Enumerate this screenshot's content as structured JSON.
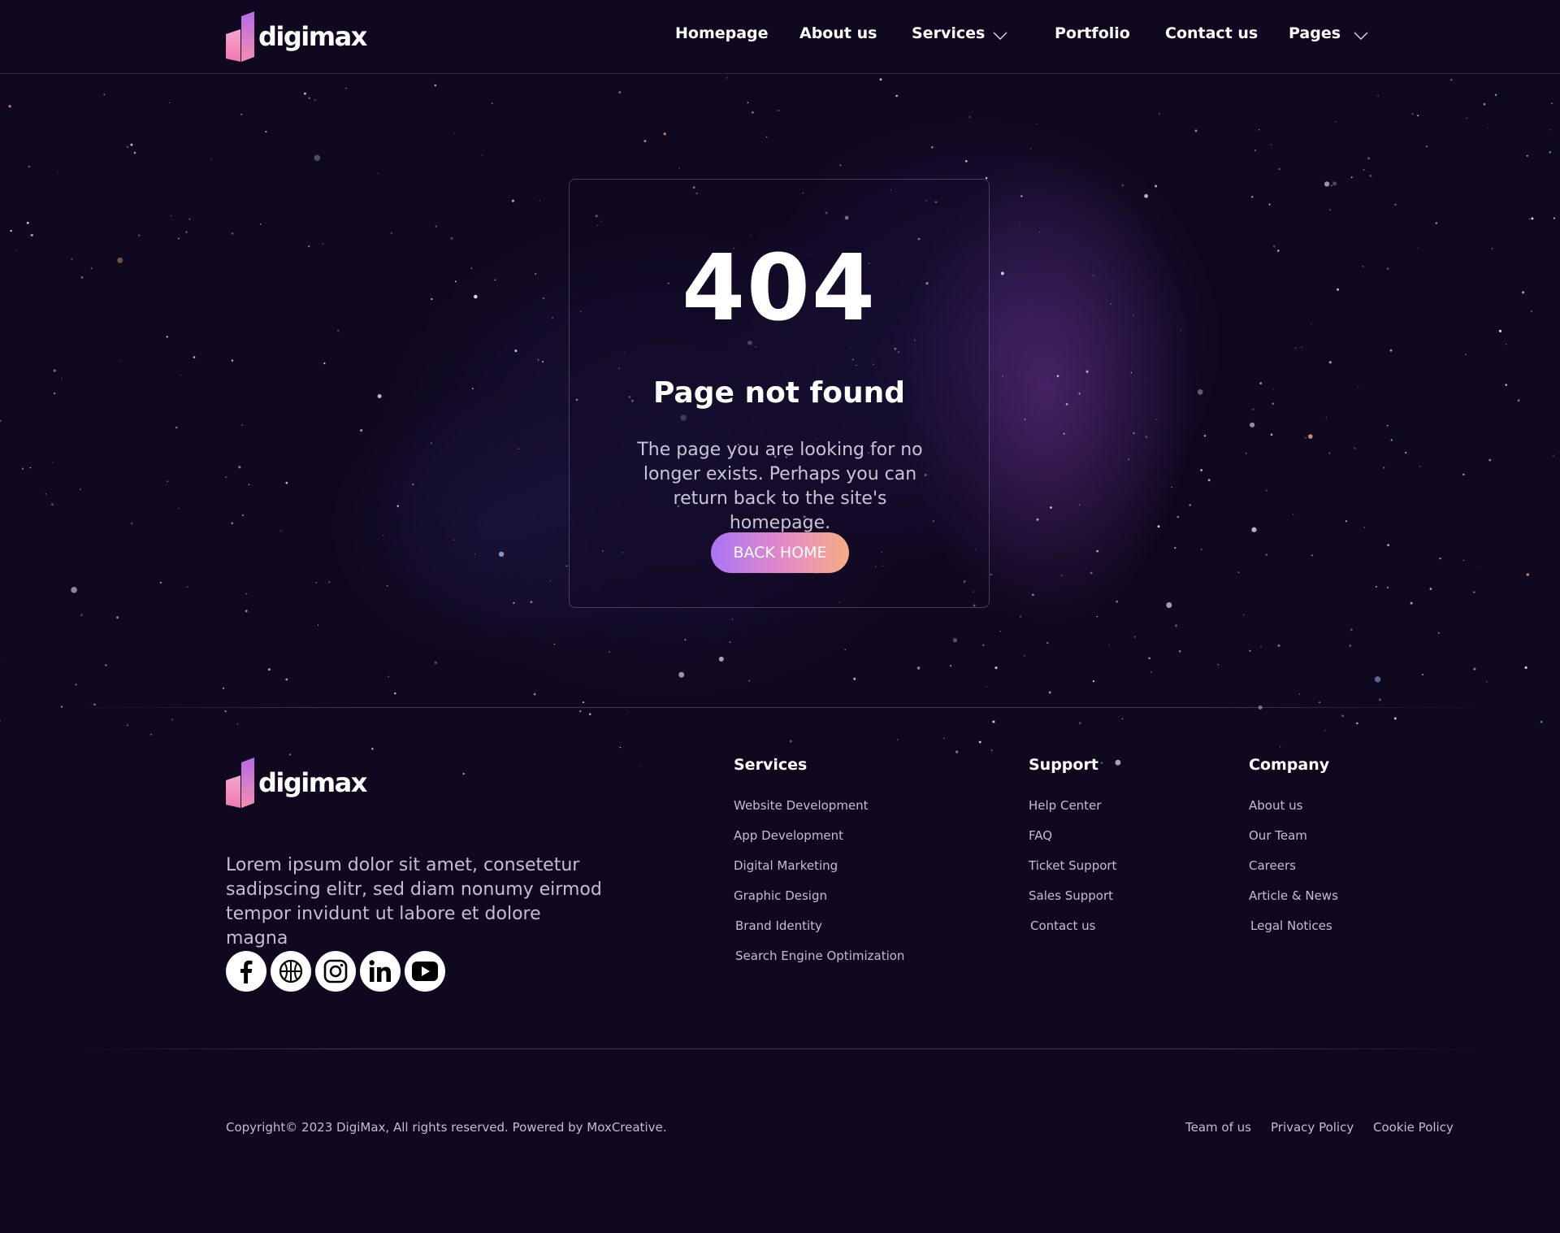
{
  "brand": {
    "name": "digimax"
  },
  "nav": {
    "items": [
      "Homepage",
      "About us",
      "Services",
      "Portfolio",
      "Contact us",
      "Pages"
    ]
  },
  "error": {
    "code": "404",
    "title": "Page not found",
    "message": "The page you are looking for no longer exists. Perhaps you can return back to the site's homepage.",
    "button": "BACK HOME"
  },
  "footer": {
    "description": "Lorem ipsum dolor sit amet, consetetur sadipscing elitr, sed diam nonumy eirmod tempor invidunt ut labore et dolore magna",
    "socials": [
      "facebook-icon",
      "dribbble-icon",
      "instagram-icon",
      "linkedin-icon",
      "youtube-icon"
    ],
    "columns": [
      {
        "title": "Services",
        "links": [
          "Website Development",
          "App Development",
          "Digital Marketing",
          "Graphic Design",
          "Brand Identity",
          "Search Engine Optimization"
        ]
      },
      {
        "title": "Support",
        "links": [
          "Help Center",
          "FAQ",
          "Ticket Support",
          "Sales Support",
          "Contact us"
        ]
      },
      {
        "title": "Company",
        "links": [
          "About us",
          "Our Team",
          "Careers",
          "Article & News",
          "Legal Notices"
        ]
      }
    ],
    "copyright": "Copyright© 2023 DigiMax, All rights reserved. Powered by MoxCreative.",
    "bottom_links": [
      "Team of us",
      "Privacy Policy",
      "Cookie Policy"
    ]
  },
  "colors": {
    "background": "#0f081e",
    "accent_start": "#a974f6",
    "accent_end": "#f6ac84"
  }
}
